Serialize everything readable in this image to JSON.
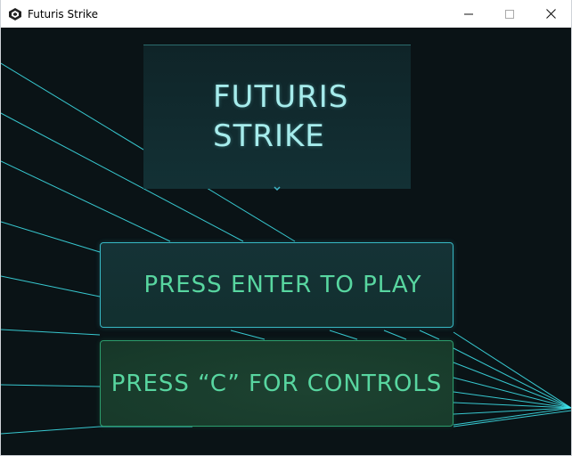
{
  "window": {
    "title": "Futuris Strike",
    "app_icon": "unity-logo-icon",
    "controls": [
      "minimize-icon",
      "maximize-icon",
      "close-icon"
    ]
  },
  "game": {
    "title": "FUTURIS\nSTRIKE",
    "title_icon": "chevron-down-icon",
    "play_button_label": "PRESS ENTER TO PLAY",
    "controls_button_label": "PRESS “C” FOR CONTROLS"
  },
  "colors": {
    "background": "#0a1316",
    "ray": "#3fe7f0",
    "title_text": "#a6ecec",
    "button_text": "#58d6a0",
    "play_border": "#37b8c4",
    "controls_border": "#2c9c6c"
  }
}
